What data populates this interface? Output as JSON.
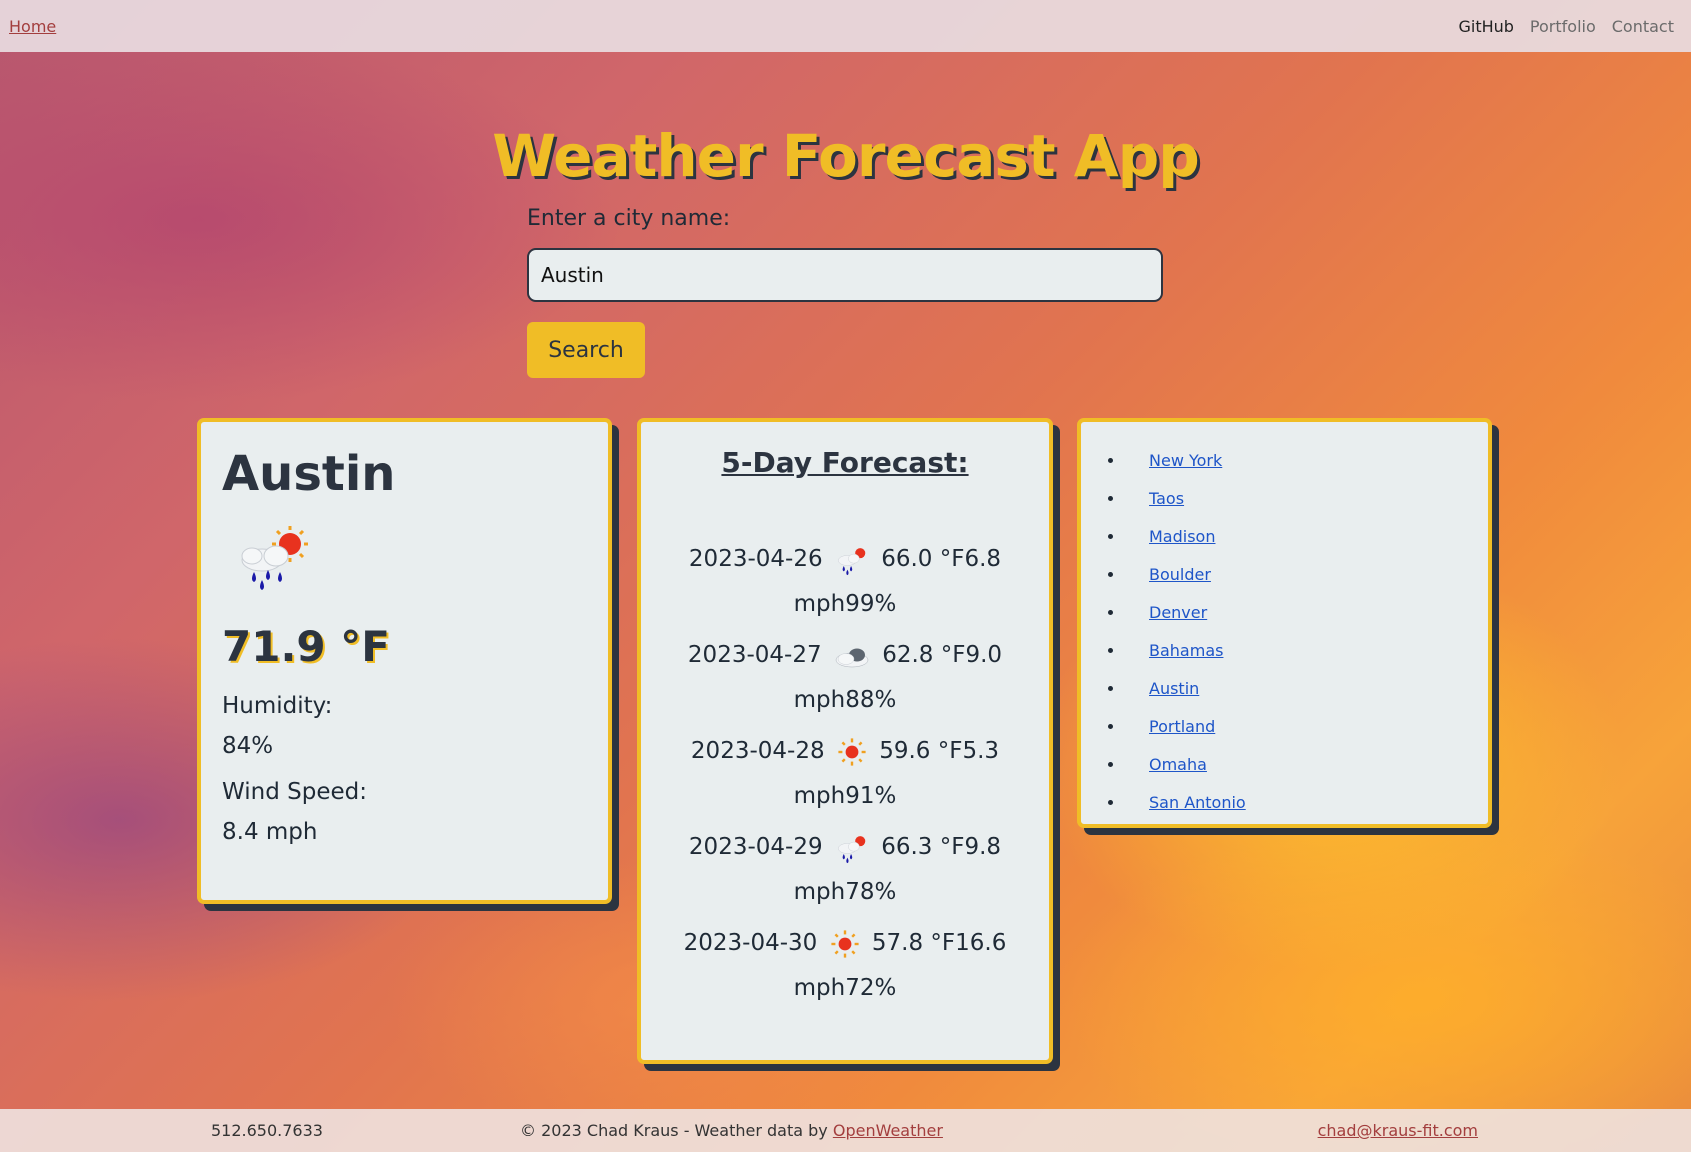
{
  "nav": {
    "home": "Home",
    "links": [
      "GitHub",
      "Portfolio",
      "Contact"
    ]
  },
  "title": "Weather Forecast App",
  "search": {
    "label": "Enter a city name:",
    "value": "Austin",
    "button": "Search"
  },
  "current": {
    "city": "Austin",
    "icon": "rain-sun-icon",
    "temp": "71.9 °F",
    "humidity_label": "Humidity:",
    "humidity": "84%",
    "wind_label": "Wind Speed:",
    "wind": "8.4 mph"
  },
  "forecast": {
    "heading": "5-Day Forecast:",
    "days": [
      {
        "date": "2023-04-26",
        "icon": "rain-sun-icon",
        "rest": "66.0 °F6.8 mph99%"
      },
      {
        "date": "2023-04-27",
        "icon": "cloud-icon",
        "rest": "62.8 °F9.0 mph88%"
      },
      {
        "date": "2023-04-28",
        "icon": "sun-icon",
        "rest": "59.6 °F5.3 mph91%"
      },
      {
        "date": "2023-04-29",
        "icon": "rain-sun-icon",
        "rest": "66.3 °F9.8 mph78%"
      },
      {
        "date": "2023-04-30",
        "icon": "sun-icon",
        "rest": "57.8 °F16.6 mph72%"
      }
    ]
  },
  "history": [
    "New York",
    "Taos",
    "Madison",
    "Boulder",
    "Denver",
    "Bahamas",
    "Austin",
    "Portland",
    "Omaha",
    "San Antonio"
  ],
  "footer": {
    "phone": "512.650.7633",
    "copyright": "© 2023 Chad Kraus - Weather data by ",
    "provider": "OpenWeather",
    "email": "chad@kraus-fit.com"
  }
}
